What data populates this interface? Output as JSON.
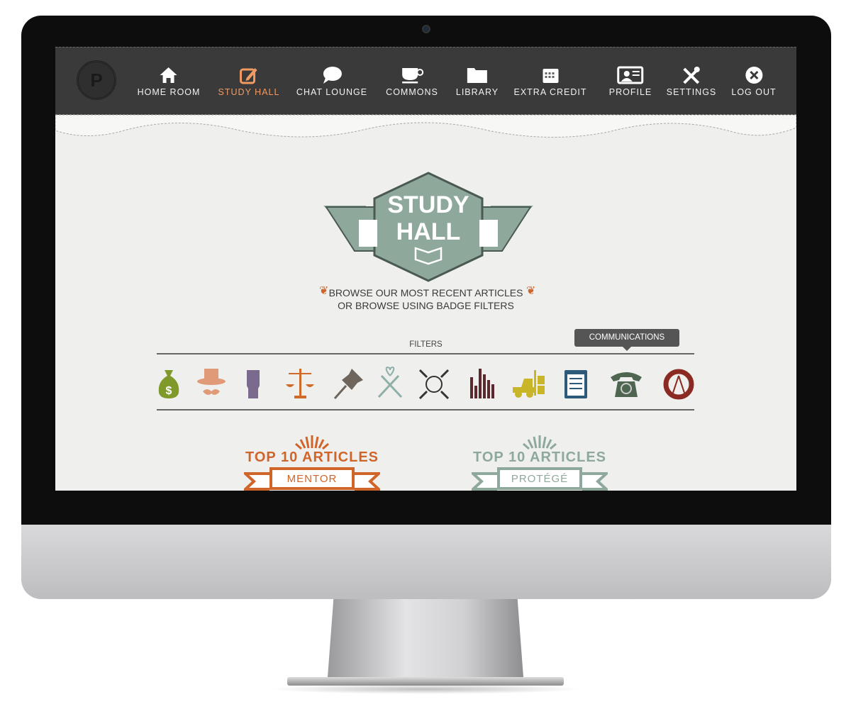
{
  "nav": {
    "logo_letter": "P",
    "items": [
      {
        "label": "HOME ROOM",
        "icon": "home-icon"
      },
      {
        "label": "STUDY HALL",
        "icon": "edit-icon",
        "active": true
      },
      {
        "label": "CHAT LOUNGE",
        "icon": "chat-bubble-icon"
      },
      {
        "label": "COMMONS",
        "icon": "coffee-cup-icon"
      },
      {
        "label": "LIBRARY",
        "icon": "folder-icon"
      },
      {
        "label": "EXTRA CREDIT",
        "icon": "calendar-icon"
      },
      {
        "label": "PROFILE",
        "icon": "id-card-icon"
      },
      {
        "label": "SETTINGS",
        "icon": "tools-icon"
      },
      {
        "label": "LOG OUT",
        "icon": "close-circle-icon"
      }
    ],
    "active_color": "#f29a62"
  },
  "hero": {
    "badge_line1": "STUDY",
    "badge_line2": "HALL",
    "badge_color": "#8fa89c",
    "subtitle_line1": "BROWSE OUR MOST RECENT ARTICLES",
    "subtitle_line2": "OR BROWSE USING BADGE FILTERS"
  },
  "filters": {
    "label": "FILTERS",
    "tooltip": "COMMUNICATIONS",
    "items": [
      {
        "icon": "money-bag-icon",
        "color": "#7f9a2a"
      },
      {
        "icon": "top-hat-mustache-icon",
        "color": "#e09a78"
      },
      {
        "icon": "fist-icon",
        "color": "#7a6a8e"
      },
      {
        "icon": "scales-icon",
        "color": "#d06a2a"
      },
      {
        "icon": "pushpin-icon",
        "color": "#6e655c"
      },
      {
        "icon": "crossed-swords-heart-icon",
        "color": "#8fb0a8"
      },
      {
        "icon": "circle-arrows-icon",
        "color": "#333333"
      },
      {
        "icon": "bar-chart-icon",
        "color": "#5a2a2e"
      },
      {
        "icon": "forklift-icon",
        "color": "#c9b628"
      },
      {
        "icon": "clipboard-icon",
        "color": "#2e5a7a"
      },
      {
        "icon": "telephone-icon",
        "color": "#4e6650"
      },
      {
        "icon": "compass-cycle-icon",
        "color": "#8a2a22"
      }
    ]
  },
  "top10": [
    {
      "title": "TOP 10 ARTICLES",
      "ribbon": "MENTOR",
      "color": "#d0652a"
    },
    {
      "title": "TOP 10 ARTICLES",
      "ribbon": "PROTÉGÉ",
      "color": "#8fa89c"
    }
  ]
}
